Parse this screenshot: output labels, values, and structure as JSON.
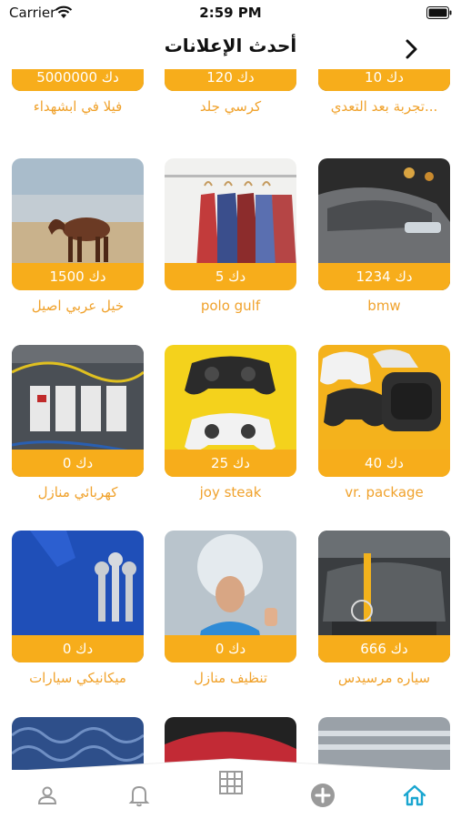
{
  "status": {
    "carrier": "Carrier",
    "time": "2:59 PM"
  },
  "nav": {
    "title": "أحدث الإعلانات",
    "back_icon": "chevron-back-icon"
  },
  "colors": {
    "accent": "#f7ad1b",
    "title_text": "#f0a22c",
    "tab_active": "#1aa6d0",
    "tab_inactive": "#9a9a9a"
  },
  "listings": [
    {
      "price": "5000000 دك",
      "title": "فيلا في ابشهداء",
      "image": "villa-image"
    },
    {
      "price": "120 دك",
      "title": "كرسي جلد",
      "image": "chair-image"
    },
    {
      "price": "10 دك",
      "title": "تجربة بعد التعدي...",
      "image": "test-image"
    },
    {
      "price": "1500 دك",
      "title": "خيل عربي اصيل",
      "image": "horse-image"
    },
    {
      "price": "5 دك",
      "title": "polo gulf",
      "image": "shirts-image"
    },
    {
      "price": "1234 دك",
      "title": "bmw",
      "image": "car-image"
    },
    {
      "price": "0 دك",
      "title": "كهربائي منازل",
      "image": "electrical-panel-image"
    },
    {
      "price": "25 دك",
      "title": "joy steak",
      "image": "game-controllers-image"
    },
    {
      "price": "40 دك",
      "title": "vr. package",
      "image": "vr-headset-image"
    },
    {
      "price": "0 دك",
      "title": "ميكانيكي سيارات",
      "image": "wrenches-image"
    },
    {
      "price": "0 دك",
      "title": "تنظيف منازل",
      "image": "cleaning-image"
    },
    {
      "price": "666 دك",
      "title": "سياره مرسيدس",
      "image": "mercedes-image"
    }
  ],
  "tabs": [
    {
      "icon": "profile-icon",
      "active": false
    },
    {
      "icon": "bell-icon",
      "active": false
    },
    {
      "icon": "grid-icon",
      "active": false
    },
    {
      "icon": "add-icon",
      "active": false
    },
    {
      "icon": "home-icon",
      "active": true
    }
  ]
}
